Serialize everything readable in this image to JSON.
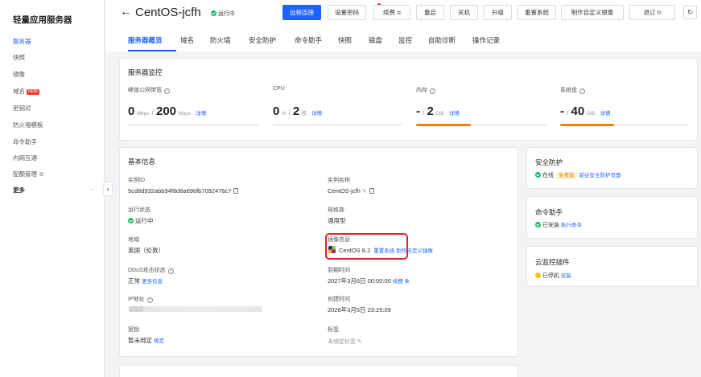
{
  "sidebar": {
    "title": "轻量应用服务器",
    "items": [
      {
        "label": "服务器"
      },
      {
        "label": "快照"
      },
      {
        "label": "镜像"
      },
      {
        "label": "域名",
        "badge": "NEW"
      },
      {
        "label": "密钥对"
      },
      {
        "label": "防火墙模板"
      },
      {
        "label": "命令助手"
      },
      {
        "label": "内网互通"
      },
      {
        "label": "配额管理"
      },
      {
        "label": "更多"
      }
    ]
  },
  "header": {
    "title": "CentOS-jcfh",
    "status": "运行中",
    "buttons": {
      "remote": "远程连接",
      "password": "设置密码",
      "renew": "续费",
      "restart": "重启",
      "shutdown": "关机",
      "upgrade": "升级",
      "reset": "重置系统",
      "custom_image": "制作自定义镜像",
      "refund": "退订"
    }
  },
  "tabs": [
    "服务器概览",
    "域名",
    "防火墙",
    "安全防护",
    "命令助手",
    "快照",
    "磁盘",
    "监控",
    "自助诊断",
    "操作记录"
  ],
  "monitor": {
    "title": "服务器监控",
    "detail_label": "详情",
    "metrics": [
      {
        "label": "峰值公网带宽",
        "used": "0",
        "used_unit": "Mbps",
        "total": "200",
        "total_unit": "Mbps",
        "usage": 0
      },
      {
        "label": "CPU",
        "used": "0",
        "used_unit": "%",
        "total": "2",
        "total_unit": "核",
        "usage": 0
      },
      {
        "label": "内存",
        "used": "-",
        "used_unit": "",
        "total": "2",
        "total_unit": "GiB",
        "usage": 0.42
      },
      {
        "label": "系统盘",
        "used": "-",
        "used_unit": "",
        "total": "40",
        "total_unit": "GiB",
        "usage": 0.42
      }
    ]
  },
  "basic": {
    "title": "基本信息",
    "instance_id_label": "实例ID",
    "instance_id": "5cd8d932abb94f8d8a696fb7092476c7",
    "instance_name_label": "实例名称",
    "instance_name": "CentOS-jcfh",
    "run_status_label": "运行状态",
    "run_status": "运行中",
    "spec_family_label": "规格族",
    "spec_family": "通用型",
    "region_label": "地域",
    "region": "英国（伦敦）",
    "image_label": "镜像信息",
    "image_name": "CentOS 8.2",
    "image_reset": "重置系统",
    "image_custom": "制作自定义镜像",
    "ddos_label": "DDoS攻击状态",
    "ddos_status": "正常",
    "ddos_more": "更多信息",
    "expire_label": "到期时间",
    "expire_time": "2027年3月6日 00:00:00",
    "expire_renew": "续费",
    "ip_label": "IP地址",
    "created_label": "创建时间",
    "created_time": "2026年3月5日 23:25:09",
    "key_label": "密钥",
    "key_status": "暂未绑定",
    "key_bind": "绑定",
    "tag_label": "标签",
    "tag_status": "未绑定标签"
  },
  "security": {
    "title": "安全防护",
    "status": "在线",
    "badge": "免费版",
    "link": "前往安全防护页面"
  },
  "command": {
    "title": "命令助手",
    "status": "已安装",
    "link": "执行命令"
  },
  "cloudmonitor": {
    "title": "云监控插件",
    "status": "已停机",
    "link": "安装"
  },
  "colors": {
    "primary": "#1f63ff",
    "progress": "#ff7a0f",
    "highlight": "#e0222a",
    "success": "#12b76a"
  }
}
